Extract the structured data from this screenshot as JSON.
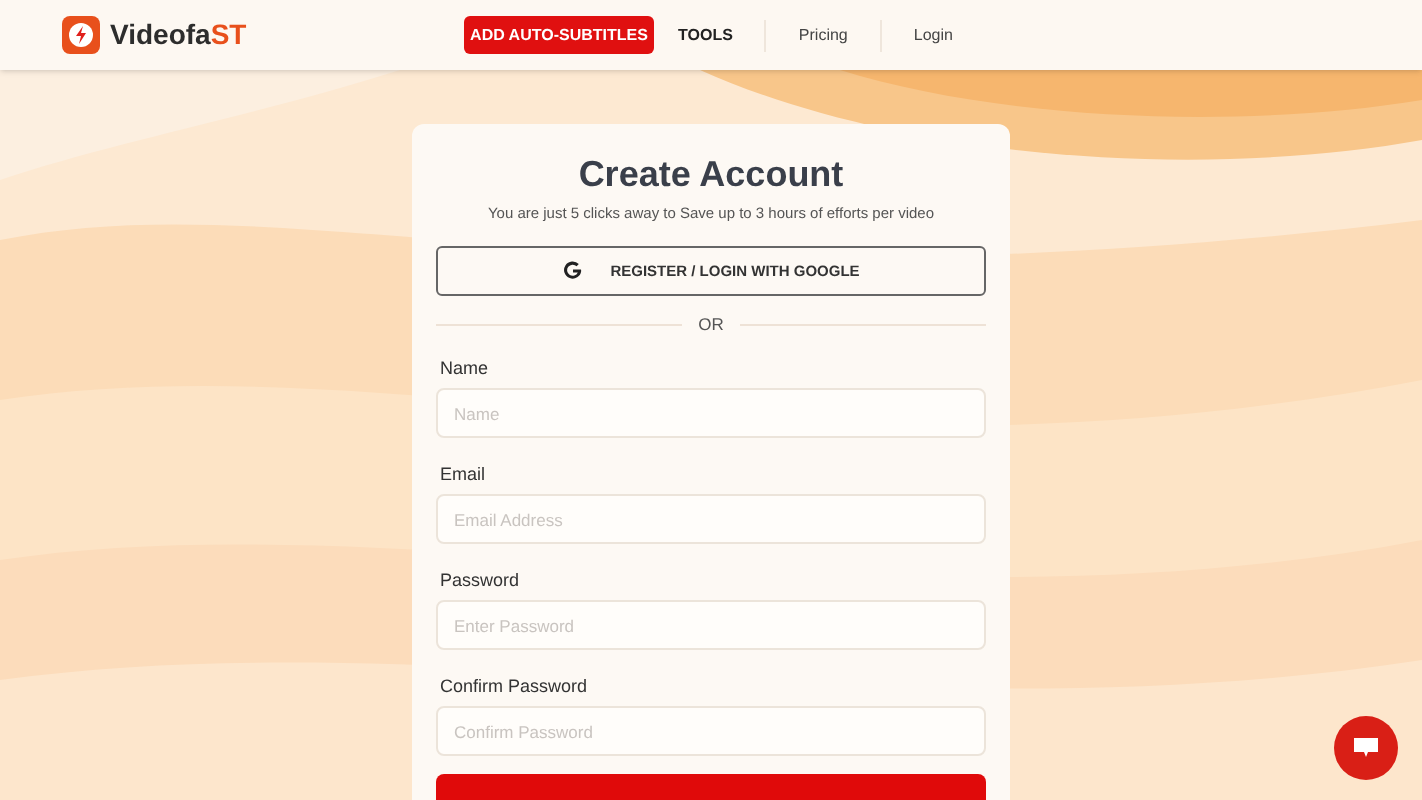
{
  "nav": {
    "brand": {
      "text": "Videofa",
      "accent": "ST"
    },
    "cta": "ADD AUTO-SUBTITLES",
    "links": [
      {
        "label": "TOOLS",
        "kind": "bold"
      },
      {
        "label": "Pricing",
        "kind": "plain"
      },
      {
        "label": "Login",
        "kind": "plain"
      }
    ]
  },
  "form": {
    "title": "Create Account",
    "subtitle": "You are just 5 clicks away to Save up to 3 hours of efforts per video",
    "google_button": "REGISTER / LOGIN WITH GOOGLE",
    "divider": "OR",
    "fields": [
      {
        "label": "Name",
        "placeholder": "Name"
      },
      {
        "label": "Email",
        "placeholder": "Email Address"
      },
      {
        "label": "Password",
        "placeholder": "Enter Password"
      },
      {
        "label": "Confirm Password",
        "placeholder": "Confirm Password"
      }
    ]
  }
}
